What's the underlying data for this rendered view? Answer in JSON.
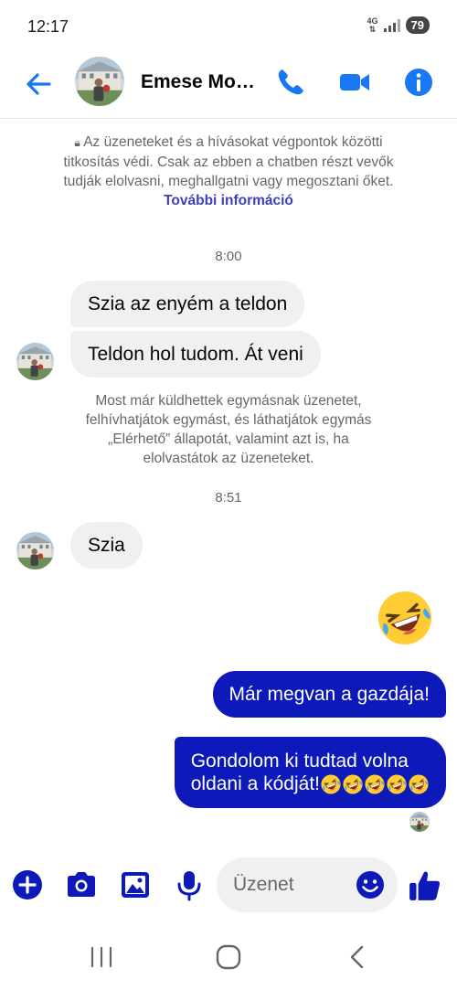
{
  "status_bar": {
    "time": "12:17",
    "network": "4G",
    "battery": "79"
  },
  "header": {
    "contact_name": "Emese Mo…",
    "icons": [
      "back-arrow-icon",
      "phone-icon",
      "video-camera-icon",
      "info-icon"
    ]
  },
  "chat": {
    "encryption_notice": "Az üzeneteket és a hívásokat végpontok közötti titkosítás védi. Csak az ebben a chatben részt vevők tudják elolvasni, meghallgatni vagy megosztani őket.",
    "encryption_link": "További információ",
    "time_1": "8:00",
    "msg_1": "Szia az enyém a teldon",
    "msg_2": "Teldon hol tudom. Át veni",
    "connect_notice": "Most már küldhettek egymásnak üzenetet, felhívhatjátok egymást, és láthatjátok egymás „Elérhető” állapotát, valamint azt is, ha elolvastátok az üzeneteket.",
    "time_2": "8:51",
    "msg_3": "Szia",
    "msg_4_emoji": "rolling-on-floor-laughing-emoji",
    "msg_5": "Már megvan a gazdája!",
    "msg_6_line1": "Gondolom ki tudtad volna",
    "msg_6_line2": "oldani a kódját!"
  },
  "composer": {
    "placeholder": "Üzenet",
    "icons": [
      "plus-icon",
      "camera-icon",
      "gallery-icon",
      "microphone-icon",
      "smile-icon",
      "thumbs-up-icon"
    ]
  },
  "navbar": {
    "icons": [
      "recent-apps-icon",
      "home-icon",
      "back-icon"
    ]
  },
  "colors": {
    "accent": "#0d19b8",
    "header_icons": "#1877f2",
    "incoming_bubble": "#f0f0f0",
    "secondary_text": "#65676b"
  }
}
